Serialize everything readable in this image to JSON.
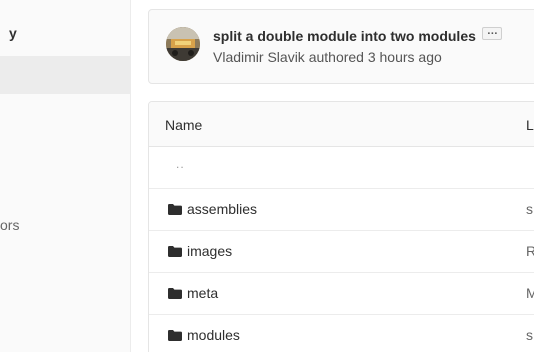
{
  "sidebar": {
    "title_fragment": "y",
    "item_fragment": "ors"
  },
  "commit": {
    "title": "split a double module into two modules",
    "ellipsis": "…",
    "author_line": "Vladimir Slavik authored 3 hours ago"
  },
  "table": {
    "header_name": "Name",
    "header_last": "L",
    "parent_link": "..",
    "rows": [
      {
        "name": "assemblies",
        "last": "s"
      },
      {
        "name": "images",
        "last": "R"
      },
      {
        "name": "meta",
        "last": "M"
      },
      {
        "name": "modules",
        "last": "s"
      }
    ]
  },
  "colors": {
    "sidebar_bg": "#fafafa",
    "sidebar_active": "#ececec",
    "border": "#e5e5e5",
    "text": "#2e2e2e",
    "muted": "#555555"
  }
}
